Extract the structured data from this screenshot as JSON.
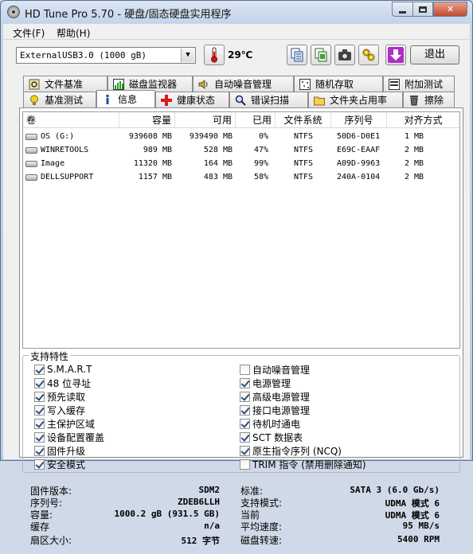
{
  "window": {
    "title": "HD Tune Pro 5.70 - 硬盘/固态硬盘实用程序"
  },
  "menu": {
    "file": "文件(F)",
    "help": "帮助(H)"
  },
  "toolbar": {
    "drive": "ExternalUSB3.0 (1000 gB)",
    "temperature": "29℃",
    "exit": "退出"
  },
  "tabs_top": [
    {
      "label": "文件基准",
      "icon": "file-benchmark-icon"
    },
    {
      "label": "磁盘监视器",
      "icon": "disk-monitor-icon"
    },
    {
      "label": "自动噪音管理",
      "icon": "speaker-icon"
    },
    {
      "label": "随机存取",
      "icon": "random-access-icon"
    },
    {
      "label": "附加测试",
      "icon": "extra-tests-icon"
    }
  ],
  "tabs_bottom": [
    {
      "label": "基准测试",
      "icon": "bulb-icon"
    },
    {
      "label": "信息",
      "icon": "info-icon"
    },
    {
      "label": "健康状态",
      "icon": "health-cross-icon"
    },
    {
      "label": "错误扫描",
      "icon": "magnifier-icon"
    },
    {
      "label": "文件夹占用率",
      "icon": "folder-icon"
    },
    {
      "label": "擦除",
      "icon": "trash-icon"
    }
  ],
  "volumes": {
    "headers": [
      "卷",
      "容量",
      "可用",
      "已用",
      "文件系统",
      "序列号",
      "对齐方式"
    ],
    "rows": [
      {
        "name": "OS (G:)",
        "capacity": "939608 MB",
        "free": "939490 MB",
        "used": "0%",
        "fs": "NTFS",
        "serial": "50D6-D0E1",
        "align": "1 MB"
      },
      {
        "name": "WINRETOOLS",
        "capacity": "989 MB",
        "free": "528 MB",
        "used": "47%",
        "fs": "NTFS",
        "serial": "E69C-EAAF",
        "align": "2 MB"
      },
      {
        "name": "Image",
        "capacity": "11320 MB",
        "free": "164 MB",
        "used": "99%",
        "fs": "NTFS",
        "serial": "A09D-9963",
        "align": "2 MB"
      },
      {
        "name": "DELLSUPPORT",
        "capacity": "1157 MB",
        "free": "483 MB",
        "used": "58%",
        "fs": "NTFS",
        "serial": "240A-0104",
        "align": "2 MB"
      }
    ]
  },
  "features": {
    "title": "支持特性",
    "left": [
      {
        "label": "S.M.A.R.T",
        "checked": true
      },
      {
        "label": "48 位寻址",
        "checked": true
      },
      {
        "label": "预先读取",
        "checked": true
      },
      {
        "label": "写入缓存",
        "checked": true
      },
      {
        "label": "主保护区域",
        "checked": true
      },
      {
        "label": "设备配置覆盖",
        "checked": true
      },
      {
        "label": "固件升级",
        "checked": true
      },
      {
        "label": "安全模式",
        "checked": true
      }
    ],
    "right": [
      {
        "label": "自动噪音管理",
        "checked": false
      },
      {
        "label": "电源管理",
        "checked": true
      },
      {
        "label": "高级电源管理",
        "checked": true
      },
      {
        "label": "接口电源管理",
        "checked": true
      },
      {
        "label": "待机时通电",
        "checked": true
      },
      {
        "label": "SCT 数据表",
        "checked": true
      },
      {
        "label": "原生指令序列 (NCQ)",
        "checked": true
      },
      {
        "label": "TRIM 指令 (禁用删除通知)",
        "checked": false
      }
    ]
  },
  "info": {
    "left": [
      {
        "label": "固件版本:",
        "value": "SDM2"
      },
      {
        "label": "序列号:",
        "value": "ZDEB6LLH"
      },
      {
        "label": "容量:",
        "value": "1000.2 gB (931.5 GB)"
      },
      {
        "label": "缓存",
        "value": "n/a"
      },
      {
        "label": "扇区大小:",
        "value": "512 字节"
      }
    ],
    "right": [
      {
        "label": "标准:",
        "value": "SATA 3 (6.0 Gb/s)"
      },
      {
        "label": "支持模式:",
        "value": "UDMA 模式 6"
      },
      {
        "label": "当前",
        "value": "UDMA 模式 6"
      },
      {
        "label": "平均速度:",
        "value": "95 MB/s"
      },
      {
        "label": "磁盘转速:",
        "value": "5400 RPM"
      }
    ]
  }
}
